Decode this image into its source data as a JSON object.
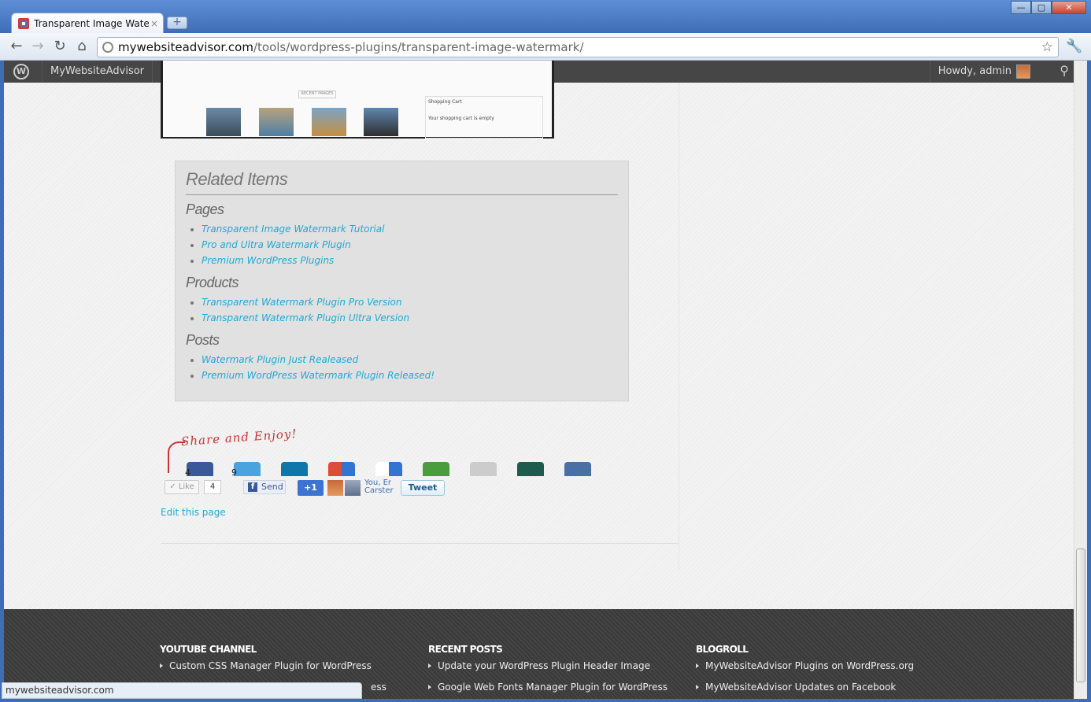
{
  "browser": {
    "tab_title": "Transparent Image Waterm",
    "tab_close": "×",
    "new_tab": "+",
    "url_domain": "mywebsiteadvisor.com",
    "url_path": "/tools/wordpress-plugins/transparent-image-watermark/",
    "window_buttons": [
      "—",
      "▢",
      "✕"
    ],
    "status_text": "mywebsiteadvisor.com"
  },
  "adminbar": {
    "site_name": "MyWebsiteAdvisor",
    "howdy": "Howdy, admin"
  },
  "screenshot": {
    "recent_images": "RECENT IMAGES",
    "cart_title": "Shopping Cart",
    "cart_text": "Your shopping cart is empty"
  },
  "related": {
    "title": "Related Items",
    "pages_heading": "Pages",
    "pages": [
      "Transparent Image Watermark Tutorial",
      "Pro and Ultra Watermark Plugin",
      "Premium WordPress Plugins"
    ],
    "products_heading": "Products",
    "products": [
      "Transparent Watermark Plugin Pro Version",
      "Transparent Watermark Plugin Ultra Version"
    ],
    "posts_heading": "Posts",
    "posts": [
      "Watermark Plugin Just Realeased",
      "Premium WordPress Watermark Plugin Released!"
    ]
  },
  "share": {
    "title": "Share and Enjoy!",
    "facebook_count": "4",
    "twitter_count": "9",
    "like_label": "Like",
    "like_count": "4",
    "send_label": "Send",
    "plus_label": "+1",
    "plus_text_line1": "You, Er",
    "plus_text_line2": "Carster",
    "tweet_label": "Tweet",
    "edit_link": "Edit this page",
    "colors": {
      "facebook": "#3b5998",
      "twitter": "#4aa3df",
      "linkedin": "#0e76a8",
      "google": "#dd4b39",
      "delicious": "#3274d1",
      "stumble": "#4b9b3f",
      "reddit": "#cccccc",
      "digg": "#1d5b4d",
      "posterous": "#4a6fa5"
    }
  },
  "footer": {
    "youtube_heading": "YOUTUBE CHANNEL",
    "youtube_items": [
      "Custom CSS Manager Plugin for WordPress",
      "ess"
    ],
    "recent_heading": "RECENT POSTS",
    "recent_items": [
      "Update your WordPress Plugin Header Image",
      "Google Web Fonts Manager Plugin for WordPress"
    ],
    "blogroll_heading": "BLOGROLL",
    "blogroll_items": [
      "MyWebsiteAdvisor Plugins on WordPress.org",
      "MyWebsiteAdvisor Updates on Facebook"
    ]
  }
}
